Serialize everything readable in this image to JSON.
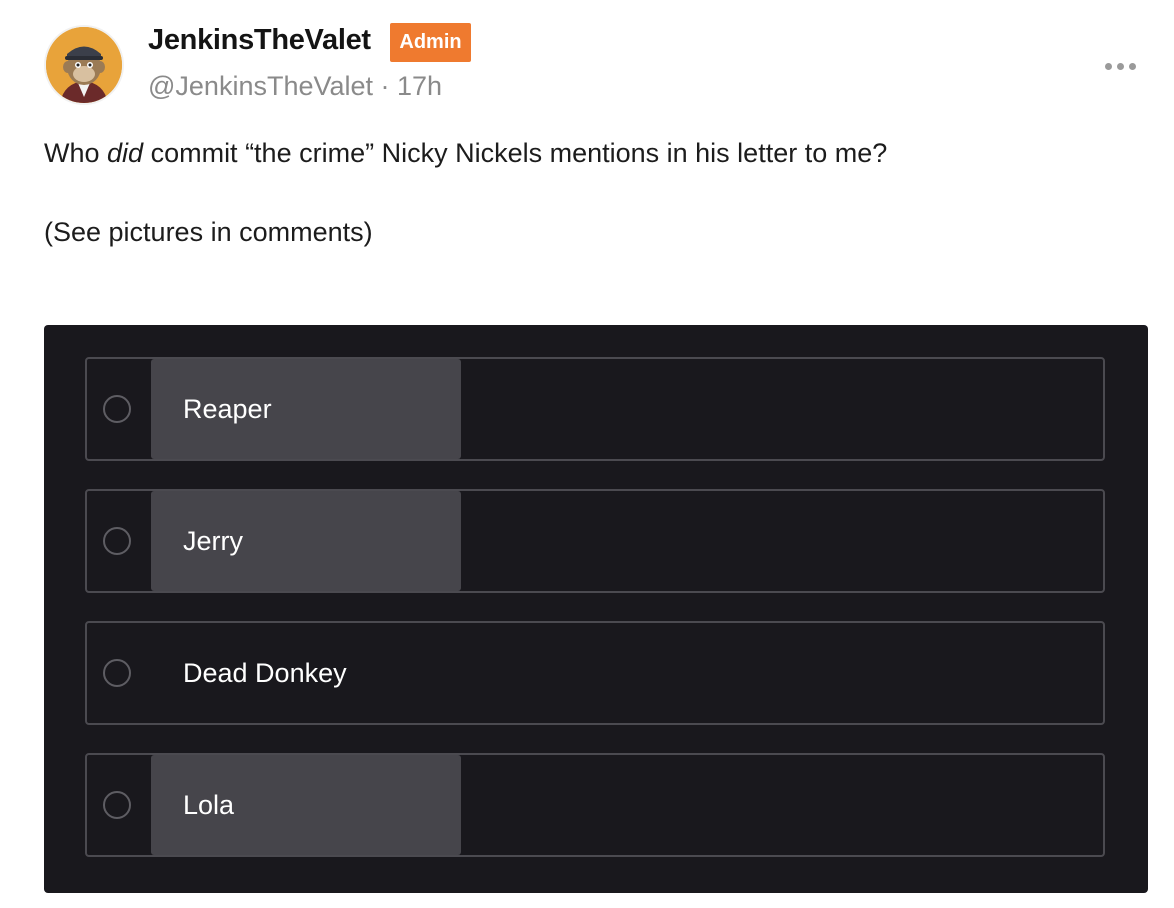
{
  "post": {
    "author_name": "JenkinsTheValet",
    "badge": "Admin",
    "meta": "@JenkinsTheValet · 17h",
    "text_before": "Who ",
    "text_emphasis": "did",
    "text_after": " commit “the crime” Nicky Nickels mentions in his letter to me?",
    "subtext": "(See pictures in comments)"
  },
  "poll": {
    "options": [
      {
        "label": "Reaper",
        "bar": 0.3
      },
      {
        "label": "Jerry",
        "bar": 0.3
      },
      {
        "label": "Dead Donkey",
        "bar": 0
      },
      {
        "label": "Lola",
        "bar": 0.3
      }
    ]
  },
  "colors": {
    "badge": "#ef7a2f",
    "poll_background": "#19181d",
    "option_bar": "#46454b"
  },
  "icons": {
    "avatar": "ape-avatar",
    "menu": "more-horizontal-icon"
  }
}
